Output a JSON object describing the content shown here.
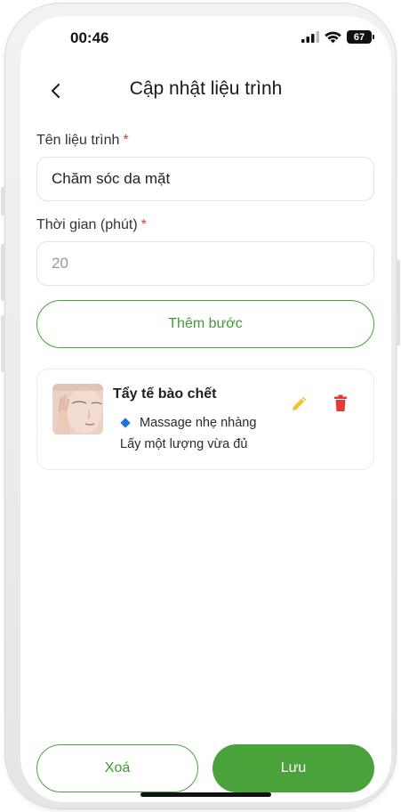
{
  "status_bar": {
    "time": "00:46",
    "battery": "67"
  },
  "header": {
    "title": "Cập nhật liệu trình",
    "back_icon": "chevron-left-icon"
  },
  "form": {
    "name_label": "Tên liệu trình",
    "name_value": "Chăm sóc da mặt",
    "duration_label": "Thời gian (phút)",
    "duration_placeholder": "20",
    "required_mark": "*"
  },
  "add_step_label": "Thêm bước",
  "steps": [
    {
      "title": "Tẩy tế bào chết",
      "subtitle": "Massage nhẹ nhàng",
      "description": "Lấy một lượng vừa đủ",
      "edit_icon": "pencil-icon",
      "delete_icon": "trash-icon"
    }
  ],
  "footer": {
    "delete_label": "Xoá",
    "save_label": "Lưu"
  },
  "colors": {
    "primary": "#4aa33a",
    "danger": "#e53935",
    "edit": "#f2c230",
    "bullet": "#1e73d6"
  }
}
